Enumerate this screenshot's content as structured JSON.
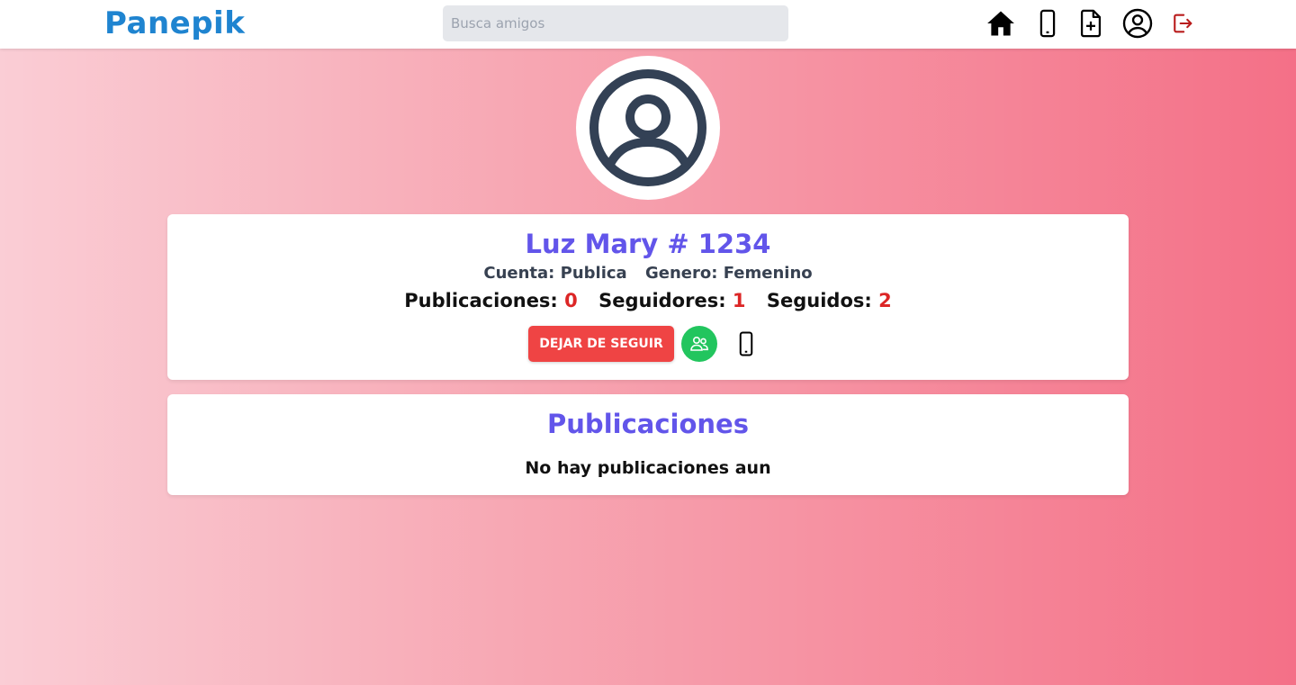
{
  "app": {
    "brand": "Panepik"
  },
  "header": {
    "search_placeholder": "Busca amigos",
    "icons": [
      "home-icon",
      "phone-icon",
      "new-post-icon",
      "profile-icon",
      "logout-icon"
    ]
  },
  "profile": {
    "name": "Luz Mary # 1234",
    "account_label": "Cuenta:",
    "account_value": "Publica",
    "gender_label": "Genero:",
    "gender_value": "Femenino",
    "stats": {
      "posts_label": "Publicaciones:",
      "posts_count": "0",
      "followers_label": "Seguidores:",
      "followers_count": "1",
      "following_label": "Seguidos:",
      "following_count": "2"
    },
    "unfollow_label": "DEJAR DE SEGUIR"
  },
  "posts": {
    "title": "Publicaciones",
    "empty_message": "No hay publicaciones aun"
  },
  "colors": {
    "brand": "#1f84d0",
    "heading": "#6255ea",
    "danger": "#ef4444",
    "success": "#22c55e"
  }
}
